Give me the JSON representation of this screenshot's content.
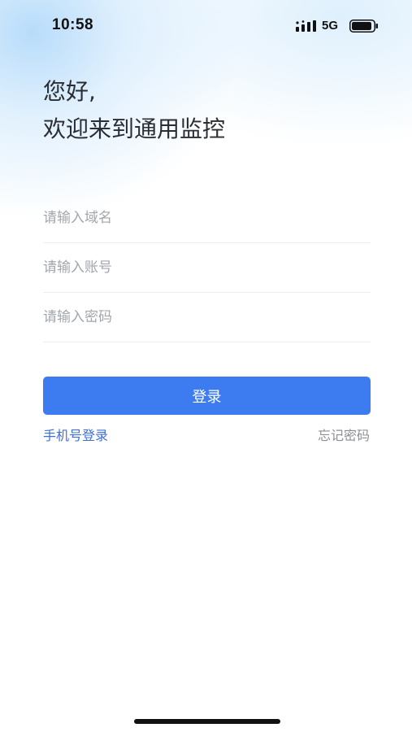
{
  "status_bar": {
    "time": "10:58",
    "network": "5G",
    "icons": [
      "signal-icon",
      "battery-icon"
    ]
  },
  "greeting": {
    "line1": "您好,",
    "line2": "欢迎来到通用监控"
  },
  "form": {
    "domain_placeholder": "请输入域名",
    "account_placeholder": "请输入账号",
    "password_placeholder": "请输入密码",
    "login_label": "登录"
  },
  "links": {
    "phone_login": "手机号登录",
    "forgot_password": "忘记密码"
  },
  "colors": {
    "primary": "#3d7cf0",
    "link": "#3d6fd9",
    "muted": "#8c9096"
  }
}
